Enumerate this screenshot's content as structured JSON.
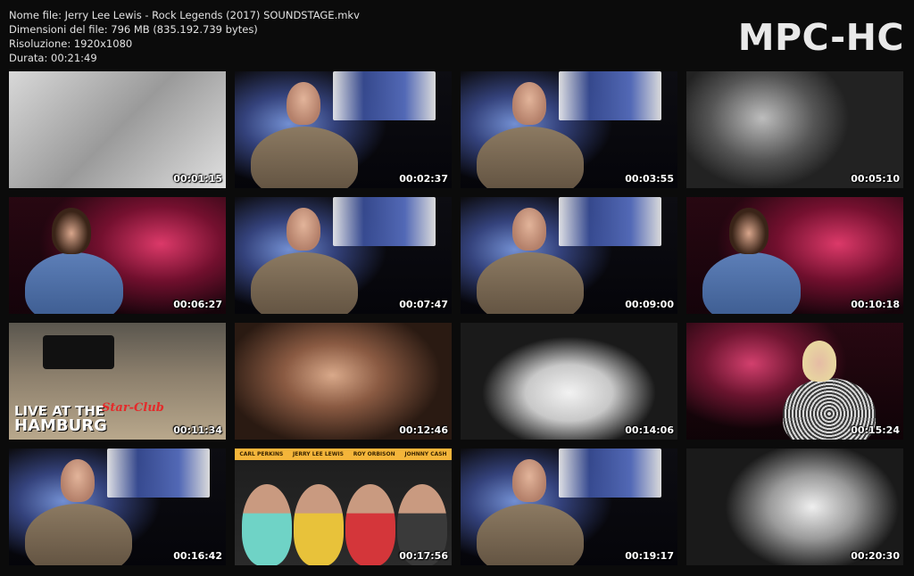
{
  "info": {
    "file_name": "Nome file: Jerry Lee Lewis - Rock Legends (2017) SOUNDSTAGE.mkv",
    "file_size": "Dimensioni del file: 796 MB (835.192.739 bytes)",
    "resolution": "Risoluzione: 1920x1080",
    "duration": "Durata: 00:21:49"
  },
  "brand": "MPC-HC",
  "thumbnails": [
    {
      "time": "00:01:15",
      "scene": "bw-photo"
    },
    {
      "time": "00:02:37",
      "scene": "interview-blue"
    },
    {
      "time": "00:03:55",
      "scene": "interview-blue"
    },
    {
      "time": "00:05:10",
      "scene": "bw-piano"
    },
    {
      "time": "00:06:27",
      "scene": "interview-red"
    },
    {
      "time": "00:07:47",
      "scene": "interview-blue"
    },
    {
      "time": "00:09:00",
      "scene": "interview-blue"
    },
    {
      "time": "00:10:18",
      "scene": "interview-red"
    },
    {
      "time": "00:11:34",
      "scene": "live-hamburg"
    },
    {
      "time": "00:12:46",
      "scene": "jerry-color"
    },
    {
      "time": "00:14:06",
      "scene": "white-jacket"
    },
    {
      "time": "00:15:24",
      "scene": "woman-red"
    },
    {
      "time": "00:16:42",
      "scene": "interview-blue"
    },
    {
      "time": "00:17:56",
      "scene": "group-color"
    },
    {
      "time": "00:19:17",
      "scene": "interview-blue"
    },
    {
      "time": "00:20:30",
      "scene": "bw-portrait"
    }
  ],
  "overlays": {
    "live_at_the": "LIVE AT THE",
    "hamburg": "HAMBURG",
    "star_club": "Star-Club",
    "group_names": [
      "CARL PERKINS",
      "JERRY LEE LEWIS",
      "ROY ORBISON",
      "JOHNNY CASH"
    ]
  }
}
